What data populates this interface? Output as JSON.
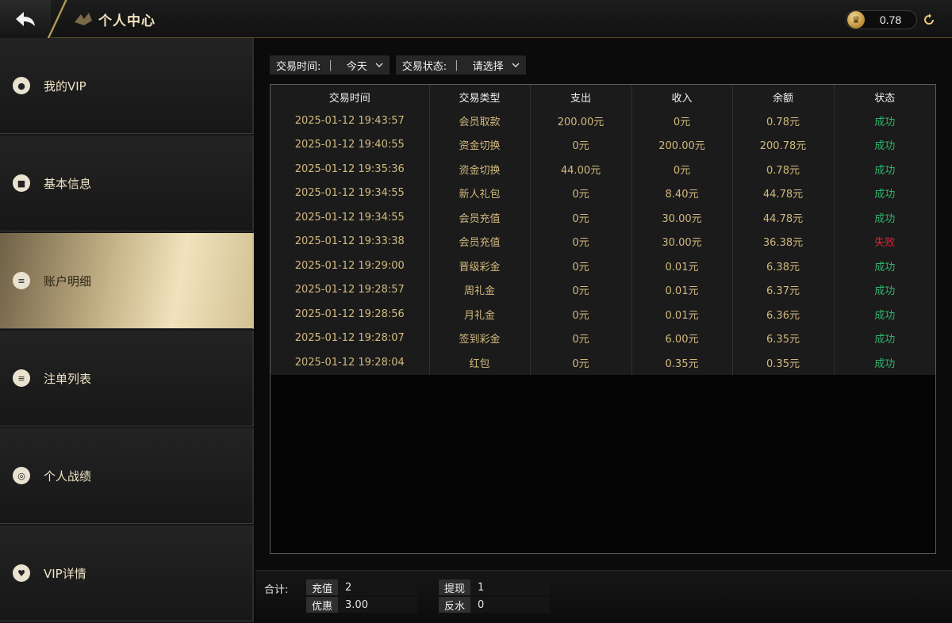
{
  "header": {
    "title": "个人中心",
    "balance": "0.78"
  },
  "sidebar": {
    "items": [
      {
        "label": "我的VIP",
        "icon": "user-icon",
        "glyph": "●"
      },
      {
        "label": "基本信息",
        "icon": "info-icon",
        "glyph": "■"
      },
      {
        "label": "账户明细",
        "icon": "ledger-icon",
        "glyph": "≡",
        "active": true
      },
      {
        "label": "注单列表",
        "icon": "list-icon",
        "glyph": "≡"
      },
      {
        "label": "个人战绩",
        "icon": "medal-icon",
        "glyph": "◎"
      },
      {
        "label": "VIP详情",
        "icon": "vip-icon",
        "glyph": "♥"
      }
    ]
  },
  "filters": {
    "time_label": "交易时间:",
    "time_value": "今天",
    "status_label": "交易状态:",
    "status_value": "请选择"
  },
  "table": {
    "headers": [
      "交易时间",
      "交易类型",
      "支出",
      "收入",
      "余额",
      "状态"
    ],
    "rows": [
      [
        "2025-01-12 19:43:57",
        "会员取款",
        "200.00元",
        "0元",
        "0.78元",
        "成功"
      ],
      [
        "2025-01-12 19:40:55",
        "资金切换",
        "0元",
        "200.00元",
        "200.78元",
        "成功"
      ],
      [
        "2025-01-12 19:35:36",
        "资金切换",
        "44.00元",
        "0元",
        "0.78元",
        "成功"
      ],
      [
        "2025-01-12 19:34:55",
        "新人礼包",
        "0元",
        "8.40元",
        "44.78元",
        "成功"
      ],
      [
        "2025-01-12 19:34:55",
        "会员充值",
        "0元",
        "30.00元",
        "44.78元",
        "成功"
      ],
      [
        "2025-01-12 19:33:38",
        "会员充值",
        "0元",
        "30.00元",
        "36.38元",
        "失败"
      ],
      [
        "2025-01-12 19:29:00",
        "晋级彩金",
        "0元",
        "0.01元",
        "6.38元",
        "成功"
      ],
      [
        "2025-01-12 19:28:57",
        "周礼金",
        "0元",
        "0.01元",
        "6.37元",
        "成功"
      ],
      [
        "2025-01-12 19:28:56",
        "月礼金",
        "0元",
        "0.01元",
        "6.36元",
        "成功"
      ],
      [
        "2025-01-12 19:28:07",
        "签到彩金",
        "0元",
        "6.00元",
        "6.35元",
        "成功"
      ],
      [
        "2025-01-12 19:28:04",
        "红包",
        "0元",
        "0.35元",
        "0.35元",
        "成功"
      ]
    ]
  },
  "footer": {
    "sum_label": "合计:",
    "recharge_label": "充值",
    "recharge_value": "2",
    "withdraw_label": "提现",
    "withdraw_value": "1",
    "bonus_label": "优惠",
    "bonus_value": "3.00",
    "rebate_label": "反水",
    "rebate_value": "0"
  },
  "colors": {
    "gold": "#d2b97e",
    "success": "#2fb36a",
    "fail": "#e0243a"
  }
}
